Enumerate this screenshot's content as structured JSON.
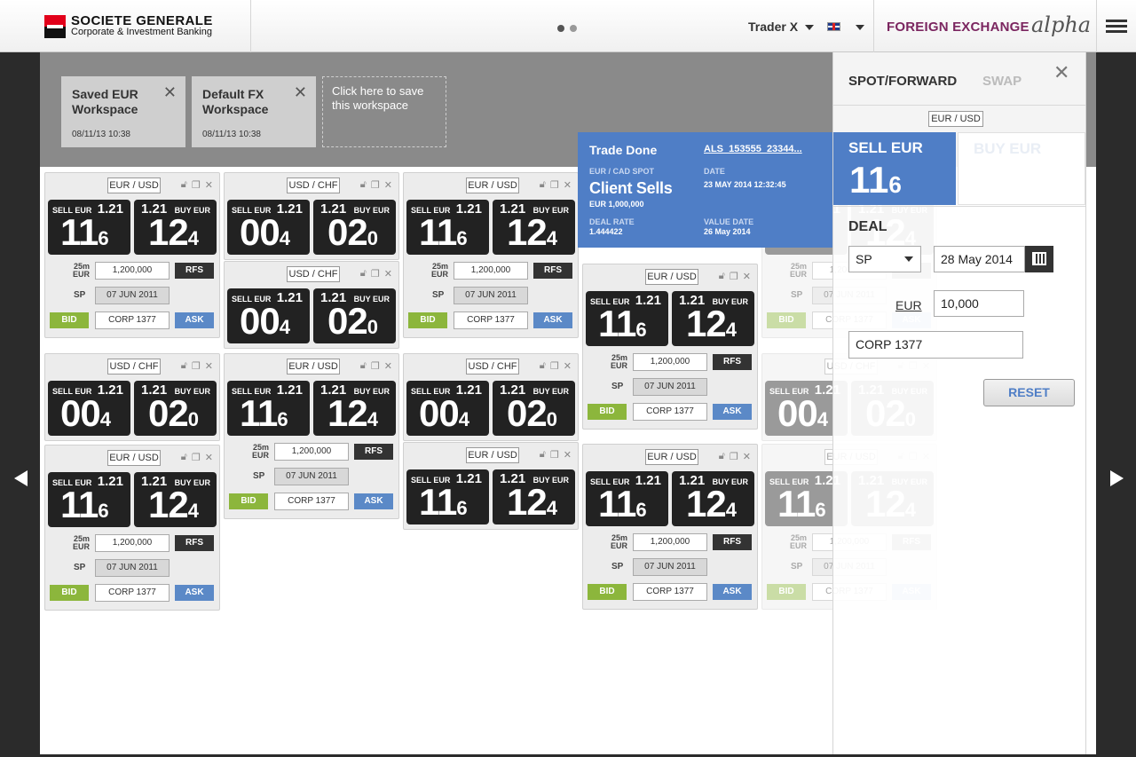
{
  "header": {
    "brand_line1": "SOCIETE GENERALE",
    "brand_line2": "Corporate & Investment Banking",
    "trader": "Trader X",
    "section": "FOREIGN EXCHANGE",
    "alpha_logo": "alpha"
  },
  "workspaces": [
    {
      "title": "Saved EUR Workspace",
      "date": "08/11/13 10:38"
    },
    {
      "title": "Default FX Workspace",
      "date": "08/11/13 10:38"
    }
  ],
  "save_workspace": "Click here to save this workspace",
  "tiles": [
    {
      "pair": "EUR / USD",
      "sell_label": "SELL EUR",
      "buy_label": "BUY EUR",
      "sell_fig": "1.21",
      "buy_fig": "1.21",
      "sell_big": "11",
      "sell_small": "6",
      "buy_big": "12",
      "buy_small": "4",
      "full": true,
      "amt_tag1": "25m",
      "amt_tag2": "EUR",
      "amount": "1,200,000",
      "rfs": "RFS",
      "tenor": "SP",
      "date": "07 JUN 2011",
      "bid": "BID",
      "account": "CORP 1377",
      "ask": "ASK"
    },
    {
      "pair": "USD / CHF",
      "sell_label": "SELL EUR",
      "buy_label": "BUY EUR",
      "sell_fig": "1.21",
      "buy_fig": "1.21",
      "sell_big": "00",
      "sell_small": "4",
      "buy_big": "02",
      "buy_small": "0"
    },
    {
      "pair": "USD / CHF",
      "sell_label": "SELL EUR",
      "buy_label": "BUY EUR",
      "sell_fig": "1.21",
      "buy_fig": "1.21",
      "sell_big": "00",
      "sell_small": "4",
      "buy_big": "02",
      "buy_small": "0"
    },
    {
      "pair": "EUR / USD",
      "sell_label": "SELL EUR",
      "buy_label": "BUY EUR",
      "sell_fig": "1.21",
      "buy_fig": "1.21",
      "sell_big": "11",
      "sell_small": "6",
      "buy_big": "12",
      "buy_small": "4",
      "amt_tag1": "25m",
      "amt_tag2": "EUR",
      "amount": "1,200,000",
      "rfs": "RFS",
      "tenor": "SP",
      "date": "07 JUN 2011",
      "bid": "BID",
      "account": "CORP 1377",
      "ask": "ASK"
    },
    {
      "pair": "USD / CHF",
      "sell_label": "SELL EUR",
      "buy_label": "BUY EUR",
      "sell_fig": "1.21",
      "buy_fig": "1.21",
      "sell_big": "00",
      "sell_small": "4",
      "buy_big": "02",
      "buy_small": "0"
    },
    {
      "pair": "EUR / USD",
      "sell_label": "SELL EUR",
      "buy_label": "BUY EUR",
      "sell_fig": "1.21",
      "buy_fig": "1.21",
      "sell_big": "11",
      "sell_small": "6",
      "buy_big": "12",
      "buy_small": "4"
    },
    {
      "pair": "USD / CHF",
      "sell_label": "SELL EUR",
      "buy_label": "BUY EUR",
      "sell_fig": "1.21",
      "buy_fig": "1.21",
      "sell_big": "00",
      "sell_small": "4",
      "buy_big": "02",
      "buy_small": "0"
    },
    {
      "pair": "EUR / USD",
      "sell_label": "SELL EUR",
      "buy_label": "BUY EUR",
      "sell_fig": "1.21",
      "buy_fig": "1.21",
      "sell_big": "11",
      "sell_small": "6",
      "buy_big": "12",
      "buy_small": "4"
    }
  ],
  "trade_done": {
    "title": "Trade Done",
    "ref": "ALS_153555_23344...",
    "spot_label": "EUR / CAD SPOT",
    "action": "Client Sells",
    "amount": "EUR 1,000,000",
    "date_label": "DATE",
    "date_value": "23 MAY 2014   12:32:45",
    "rate_label": "DEAL RATE",
    "rate_value": "1.444422",
    "value_date_label": "VALUE DATE",
    "value_date": "26 May 2014"
  },
  "panel": {
    "tab_spot": "SPOT/FORWARD",
    "tab_swap": "SWAP",
    "pair": "EUR / USD",
    "sell_label": "SELL EUR",
    "sell_big": "11",
    "sell_small": "6",
    "buy_label": "BUY EUR",
    "deal_label": "DEAL",
    "tenor": "SP",
    "date": "28 May 2014",
    "currency": "EUR",
    "amount": "10,000",
    "account": "CORP 1377",
    "reset": "RESET"
  }
}
